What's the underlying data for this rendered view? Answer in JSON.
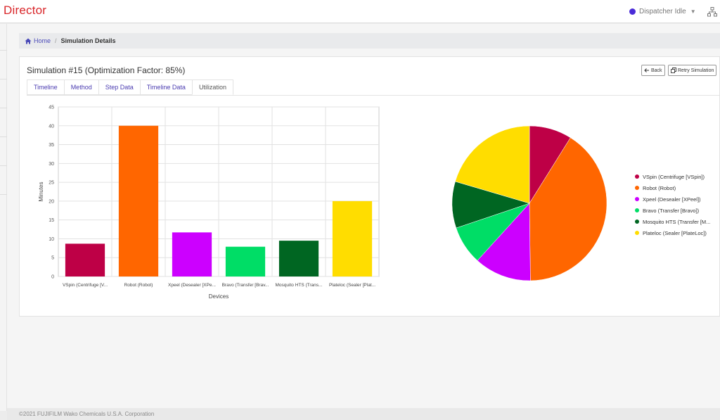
{
  "app": {
    "title": "Director"
  },
  "header": {
    "dispatcher_status": "Dispatcher Idle",
    "status_color": "#4a2bd8"
  },
  "breadcrumb": {
    "home": "Home",
    "separator": "/",
    "current": "Simulation Details"
  },
  "simulation": {
    "title": "Simulation #15 (Optimization Factor: 85%)"
  },
  "buttons": {
    "back": "Back",
    "retry": "Retry Simulation"
  },
  "tabs": [
    {
      "label": "Timeline"
    },
    {
      "label": "Method"
    },
    {
      "label": "Step Data"
    },
    {
      "label": "Timeline Data"
    },
    {
      "label": "Utilization",
      "active": true
    }
  ],
  "chart_data": [
    {
      "type": "bar",
      "categories": [
        "VSpin (Centrifuge [V...",
        "Robot (Robot)",
        "Xpeel (Desealer [XPe...",
        "Bravo (Transfer [Brav...",
        "Mosquito HTS (Trans...",
        "Plateloc (Sealer [Plat..."
      ],
      "values": [
        8.7,
        40,
        11.7,
        7.9,
        9.5,
        20
      ],
      "colors": [
        "#be0046",
        "#ff6600",
        "#cc00ff",
        "#00dd66",
        "#006622",
        "#ffdd00"
      ],
      "xlabel": "Devices",
      "ylabel": "Minutes",
      "ylim": [
        0,
        45
      ],
      "yticks": [
        0,
        5,
        10,
        15,
        20,
        25,
        30,
        35,
        40,
        45
      ],
      "grid": true
    },
    {
      "type": "pie",
      "labels": [
        "VSpin (Centrifuge [VSpin])",
        "Robot (Robot)",
        "Xpeel (Desealer [XPeel])",
        "Bravo (Transfer [Bravo])",
        "Mosquito HTS (Transfer [M...",
        "Plateloc (Sealer [PlateLoc])"
      ],
      "values": [
        8.7,
        40,
        11.7,
        7.9,
        9.5,
        20
      ],
      "colors": [
        "#be0046",
        "#ff6600",
        "#cc00ff",
        "#00dd66",
        "#006622",
        "#ffdd00"
      ],
      "legend": "right"
    }
  ],
  "footer": {
    "copyright": "©2021 FUJIFILM Wako Chemicals U.S.A. Corporation"
  }
}
